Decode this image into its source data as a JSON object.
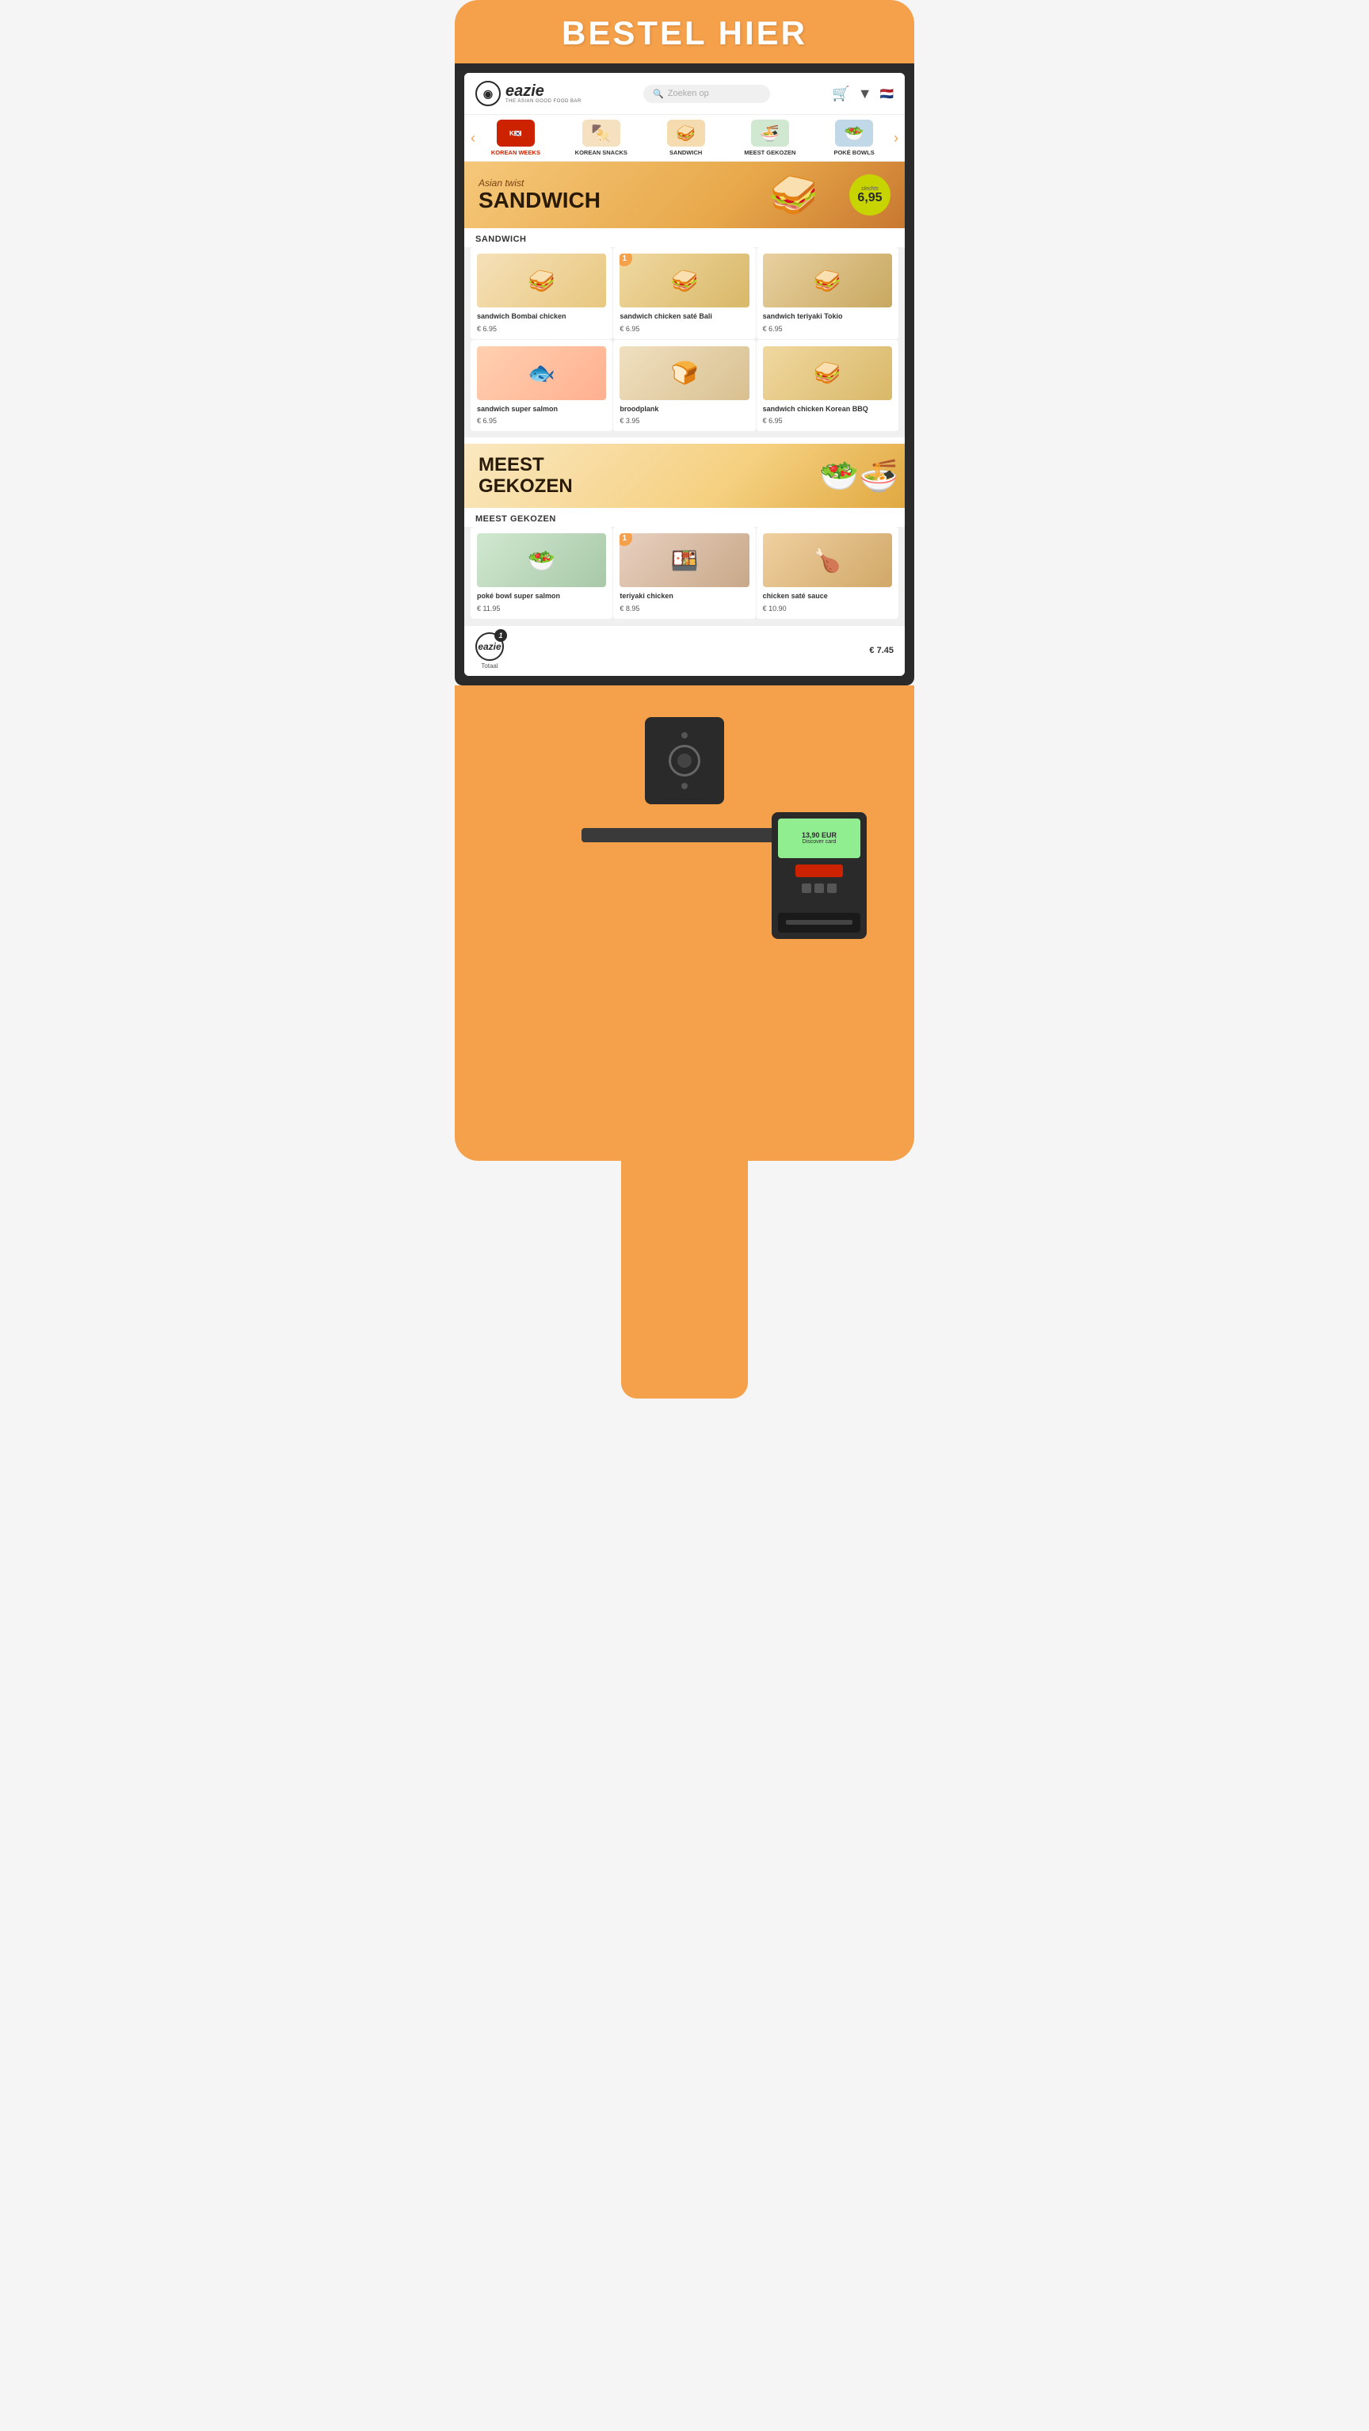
{
  "kiosk": {
    "header_title": "BESTEL HIER"
  },
  "app": {
    "logo_main": "eazie",
    "logo_sub": "THE ASIAN GOOD FOOD BAR",
    "search_placeholder": "Zoeken op",
    "categories": [
      {
        "id": "korean-weeks",
        "label": "KOREAN WEEKS",
        "emoji": "🌶️"
      },
      {
        "id": "korean-snacks",
        "label": "KOREAN SNACKS",
        "emoji": "🍢"
      },
      {
        "id": "sandwich",
        "label": "SANDWICH",
        "emoji": "🥪"
      },
      {
        "id": "meest-gekozen",
        "label": "MEEST GEKOZEN",
        "emoji": "🍜"
      },
      {
        "id": "poke-bowls",
        "label": "POKé BOWLS",
        "emoji": "🥗"
      }
    ]
  },
  "hero": {
    "subtitle": "Asian twist",
    "title": "SANDWICH",
    "price_from": "Slechts",
    "price": "6,95",
    "emoji": "🥪"
  },
  "sandwich_section": {
    "title": "SANDWICH",
    "products": [
      {
        "name": "sandwich Bombai chicken",
        "price": "€ 6.95",
        "emoji": "🥪",
        "badge": null,
        "bg": "sandwich1"
      },
      {
        "name": "sandwich chicken saté Bali",
        "price": "€ 6.95",
        "emoji": "🥪",
        "badge": "1",
        "bg": "sandwich2"
      },
      {
        "name": "sandwich teriyaki Tokio",
        "price": "€ 6.95",
        "emoji": "🥪",
        "badge": null,
        "bg": "sandwich3"
      },
      {
        "name": "sandwich super salmon",
        "price": "€ 6.95",
        "emoji": "🐟",
        "badge": null,
        "bg": "salmon"
      },
      {
        "name": "broodplank",
        "price": "€ 3.95",
        "emoji": "🍞",
        "badge": null,
        "bg": "bread"
      },
      {
        "name": "sandwich chicken Korean BBQ",
        "price": "€ 6.95",
        "emoji": "🥪",
        "badge": null,
        "bg": "sandwich1"
      }
    ]
  },
  "meest_gekozen": {
    "title": "MEEST\nGEKOZEN",
    "section_label": "MEEST GEKOZEN",
    "products": [
      {
        "name": "poké bowl super salmon",
        "price": "€ 11.95",
        "emoji": "🥗",
        "badge": null,
        "bg": "poke1"
      },
      {
        "name": "teriyaki chicken",
        "price": "€ 8.95",
        "emoji": "🍱",
        "badge": "1",
        "bg": "poke2"
      },
      {
        "name": "chicken saté sauce",
        "price": "€ 10.90",
        "emoji": "🍗",
        "badge": null,
        "bg": "poke3"
      }
    ]
  },
  "cart": {
    "logo": "eazie",
    "label": "Totaal",
    "total": "€ 7.45",
    "badge": "1"
  },
  "terminal": {
    "amount": "13,90 EUR",
    "label": "Discover card"
  }
}
